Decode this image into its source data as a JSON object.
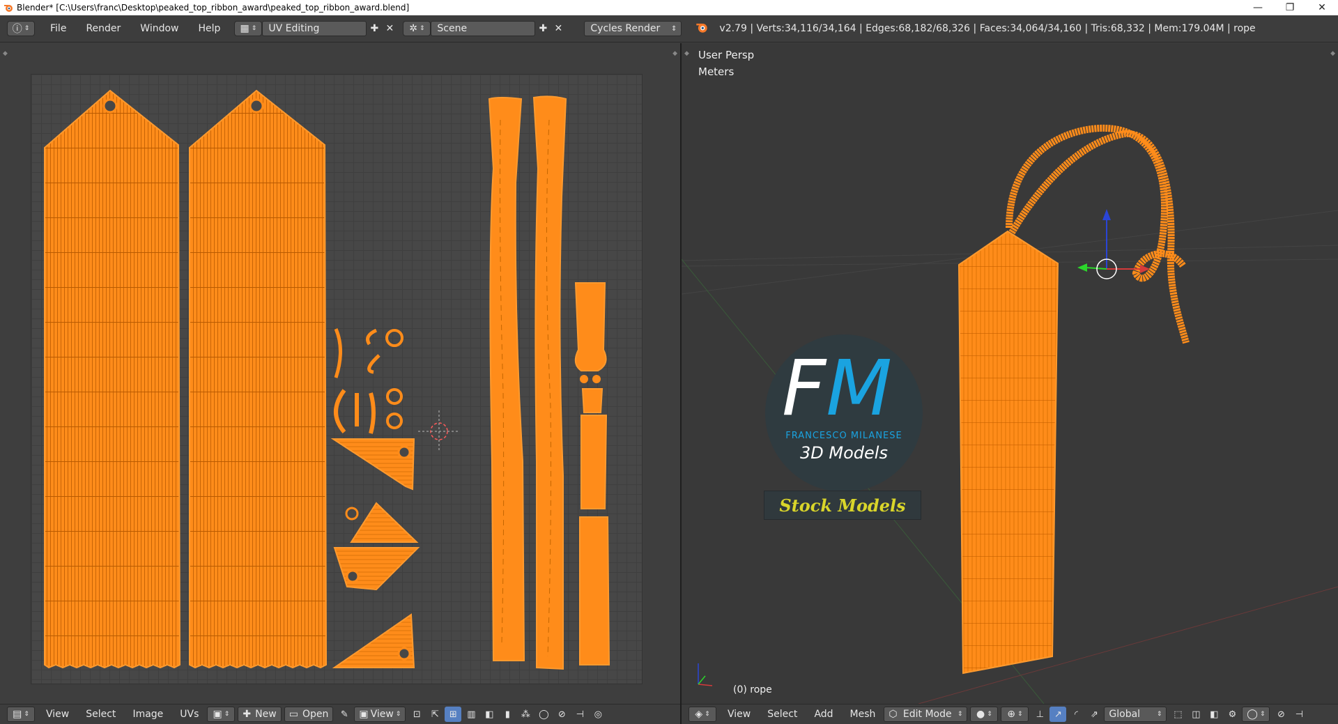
{
  "window": {
    "title": "Blender* [C:\\Users\\franc\\Desktop\\peaked_top_ribbon_award\\peaked_top_ribbon_award.blend]",
    "minimize": "—",
    "maximize": "❐",
    "close": "✕"
  },
  "topbar": {
    "menus": [
      "File",
      "Render",
      "Window",
      "Help"
    ],
    "screen_layout": "UV Editing",
    "scene": "Scene",
    "render_engine": "Cycles Render",
    "stats": "v2.79 | Verts:34,116/34,164 | Edges:68,182/68,326 | Faces:34,064/34,160 | Tris:68,332 | Mem:179.04M | rope"
  },
  "viewport": {
    "view_name": "User Persp",
    "units": "Meters",
    "object_label": "(0) rope"
  },
  "watermark": {
    "logo_letters_f": "F",
    "logo_letters_m": "M",
    "author": "FRANCESCO MILANESE",
    "tagline": "3D Models",
    "badge": "Stock Models"
  },
  "uv_header": {
    "menus": [
      "View",
      "Select",
      "Image",
      "UVs"
    ],
    "new_label": "New",
    "open_label": "Open",
    "view_label": "View"
  },
  "view3d_header": {
    "menus": [
      "View",
      "Select",
      "Add",
      "Mesh"
    ],
    "mode": "Edit Mode",
    "orientation": "Global"
  },
  "colors": {
    "mesh_orange": "#ff8c1a",
    "mesh_orange_dark": "#e06e00",
    "panel_bg": "#3d3d3d",
    "logo_blue": "#1aa3e0",
    "badge_yellow": "#d9d52a"
  }
}
